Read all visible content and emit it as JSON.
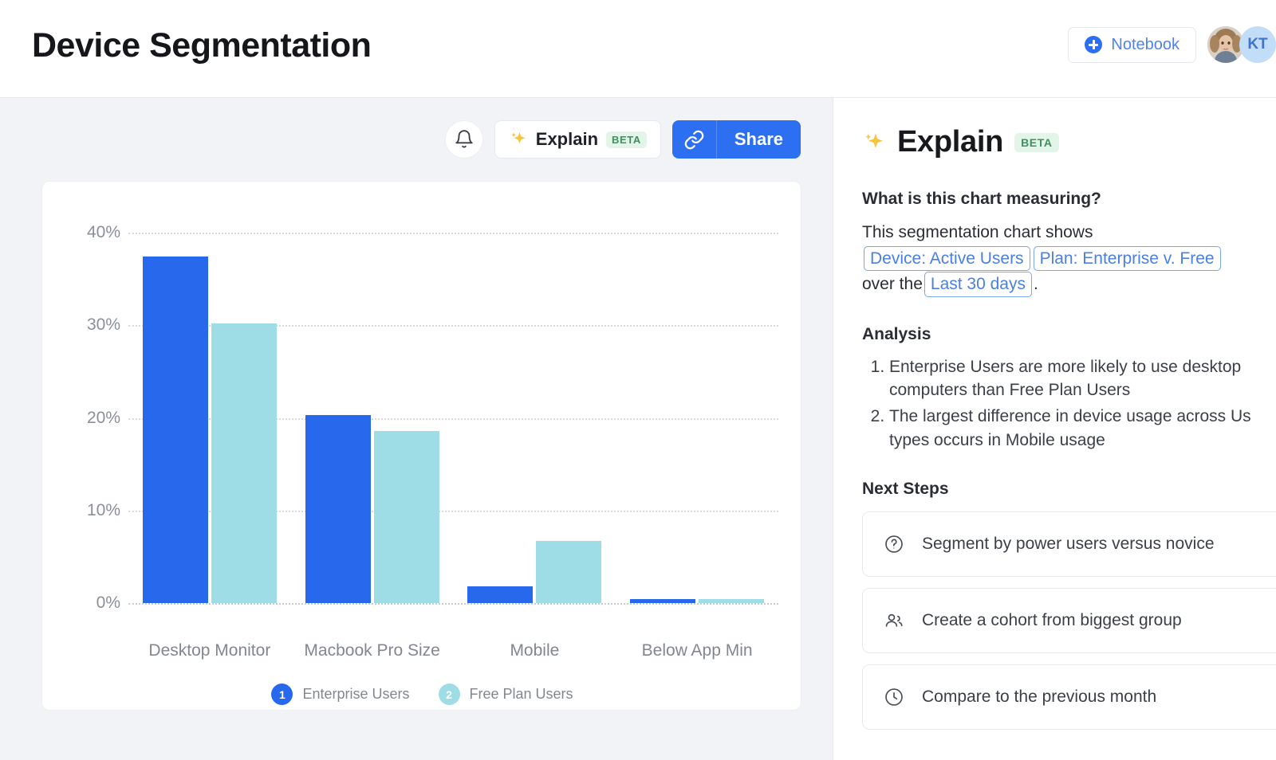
{
  "header": {
    "title": "Device Segmentation",
    "notebook_button": "Notebook",
    "avatar_initials": "KT"
  },
  "toolbar": {
    "bell_icon": "bell-icon",
    "explain_label": "Explain",
    "explain_beta": "BETA",
    "share_label": "Share",
    "share_link_icon": "link-icon"
  },
  "chart_data": {
    "type": "bar",
    "title": "Device Segmentation",
    "xlabel": "",
    "ylabel": "",
    "ylim": [
      0,
      40
    ],
    "ytick_labels": [
      "0%",
      "10%",
      "20%",
      "30%",
      "40%"
    ],
    "yticks": [
      0,
      10,
      20,
      30,
      40
    ],
    "grid": true,
    "legend_position": "bottom",
    "categories": [
      "Desktop Monitor",
      "Macbook Pro Size",
      "Mobile",
      "Below App Min"
    ],
    "series": [
      {
        "name": "Enterprise Users",
        "badge": "1",
        "color": "#2768ec",
        "values": [
          37.4,
          20.3,
          1.8,
          0.3
        ]
      },
      {
        "name": "Free Plan Users",
        "badge": "2",
        "color": "#9fdde6",
        "values": [
          30.2,
          18.6,
          6.7,
          0.3
        ]
      }
    ]
  },
  "explain": {
    "title": "Explain",
    "beta": "BETA",
    "question": "What is this chart measuring?",
    "sentence_prefix": "This segmentation chart shows",
    "chip_metric": "Device: Active Users",
    "chip_breakdown": "Plan: Enterprise v. Free",
    "sentence_mid": "over the",
    "chip_range": "Last 30 days",
    "sentence_suffix": ".",
    "analysis_heading": "Analysis",
    "analysis": [
      "Enterprise Users are more likely to use desktop",
      "computers than Free Plan Users",
      "The largest difference in device usage across Us",
      "types occurs in Mobile usage"
    ],
    "next_steps_heading": "Next Steps",
    "next_steps": [
      {
        "icon": "question-circle-icon",
        "label": "Segment by power users versus novice"
      },
      {
        "icon": "people-icon",
        "label": "Create a cohort from biggest group"
      },
      {
        "icon": "clock-icon",
        "label": "Compare to the previous month"
      }
    ]
  },
  "colors": {
    "accent_blue": "#2c6ff0",
    "series_enterprise": "#2768ec",
    "series_free": "#9fdde6",
    "page_bg": "#f1f3f7",
    "beta_green": "#3f8f60"
  }
}
